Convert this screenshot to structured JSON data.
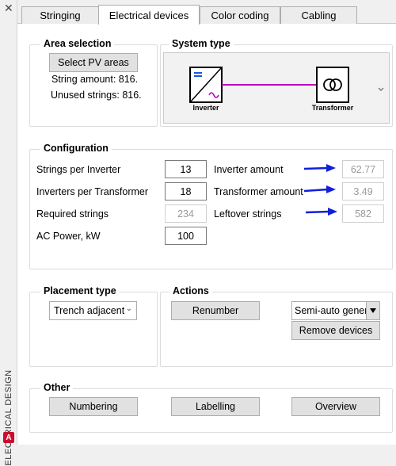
{
  "sidebar": {
    "close_icon": "close-icon",
    "title": "ELECTRICAL DESIGN",
    "badge": "A"
  },
  "tabs": [
    {
      "label": "Stringing",
      "active": false
    },
    {
      "label": "Electrical devices",
      "active": true
    },
    {
      "label": "Color coding",
      "active": false
    },
    {
      "label": "Cabling",
      "active": false
    }
  ],
  "area_selection": {
    "title": "Area selection",
    "select_button": "Select PV areas",
    "string_amount": "String amount: 816.",
    "unused_strings": "Unused strings: 816."
  },
  "system_type": {
    "title": "System type",
    "inverter_label": "Inverter",
    "transformer_label": "Transformer",
    "line_color": "#c000c0",
    "icons": [
      "inverter-icon",
      "transformer-icon",
      "chevron-down-icon"
    ]
  },
  "configuration": {
    "title": "Configuration",
    "strings_per_inverter": {
      "label": "Strings per Inverter",
      "value": "13"
    },
    "inverters_per_transformer": {
      "label": "Inverters per Transformer",
      "value": "18"
    },
    "required_strings": {
      "label": "Required strings",
      "value": "234"
    },
    "ac_power": {
      "label": "AC Power, kW",
      "value": "100"
    },
    "inverter_amount": {
      "label": "Inverter amount",
      "value": "62.77"
    },
    "transformer_amount": {
      "label": "Transformer amount",
      "value": "3.49"
    },
    "leftover_strings": {
      "label": "Leftover strings",
      "value": "582"
    },
    "arrow_color": "#1020d8"
  },
  "placement": {
    "title": "Placement type",
    "selected": "Trench adjacent"
  },
  "actions": {
    "title": "Actions",
    "renumber": "Renumber",
    "semi_auto": "Semi-auto generation",
    "remove_devices": "Remove devices"
  },
  "other": {
    "title": "Other",
    "numbering": "Numbering",
    "labelling": "Labelling",
    "overview": "Overview"
  }
}
